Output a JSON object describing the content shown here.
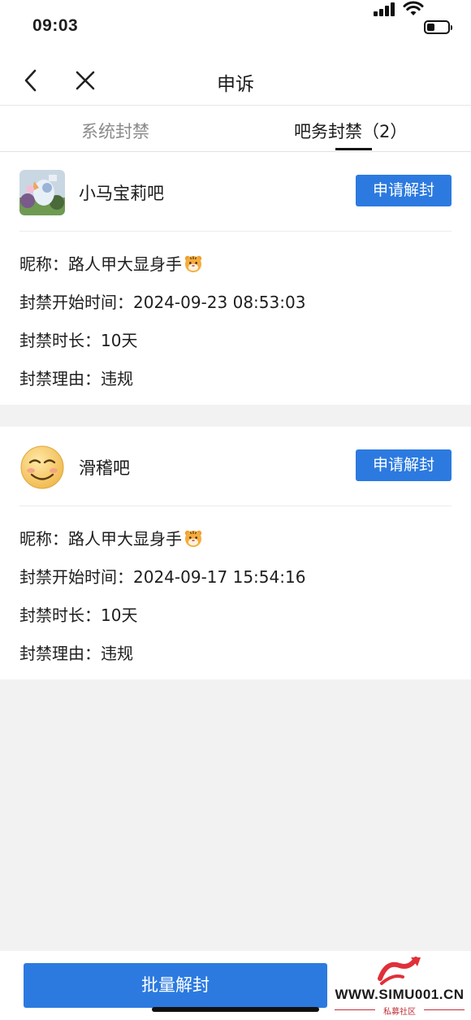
{
  "status_bar": {
    "time": "09:03"
  },
  "nav": {
    "title": "申诉"
  },
  "tabs": [
    {
      "label": "系统封禁"
    },
    {
      "label": "吧务封禁（2）"
    }
  ],
  "bans": [
    {
      "forum": "小马宝莉吧",
      "appeal_label": "申请解封",
      "nickname_label": "昵称：",
      "nickname": "路人甲大显身手",
      "start_label": "封禁开始时间：",
      "start_time": "2024-09-23 08:53:03",
      "duration_label": "封禁时长：",
      "duration": "10天",
      "reason_label": "封禁理由：",
      "reason": "违规"
    },
    {
      "forum": "滑稽吧",
      "appeal_label": "申请解封",
      "nickname_label": "昵称：",
      "nickname": "路人甲大显身手",
      "start_label": "封禁开始时间：",
      "start_time": "2024-09-17 15:54:16",
      "duration_label": "封禁时长：",
      "duration": "10天",
      "reason_label": "封禁理由：",
      "reason": "违规"
    }
  ],
  "batch_button": "批量解封",
  "watermark": {
    "text": "WWW.SIMU001.CN",
    "sub": "私募社区"
  },
  "colors": {
    "primary": "#2c7ae0",
    "background": "#f2f2f3"
  },
  "icons": [
    "back-icon",
    "close-icon",
    "tiger-emoji-icon",
    "signal-icon",
    "wifi-icon",
    "battery-icon"
  ]
}
